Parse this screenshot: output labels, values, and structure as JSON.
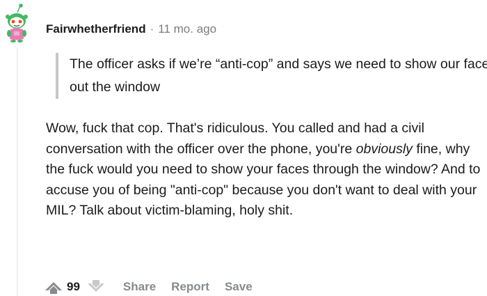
{
  "comment": {
    "author": "Fairwhetherfriend",
    "separator": "·",
    "timestamp": "11 mo. ago",
    "quote": "The officer asks if we’re “anti-cop” and says we need to show our faces out the window",
    "body_part1": "Wow, fuck that cop. That's ridiculous. You called and had a civil conversation with the officer over the phone, you're ",
    "body_emphasis": "obviously",
    "body_part2": " fine, why the fuck would you need to show your faces through the window? And to accuse you of being \"anti-cop\" because you don't want to deal with your MIL? Talk about victim-blaming, holy shit."
  },
  "actions": {
    "score": "99",
    "share_label": "Share",
    "report_label": "Report",
    "save_label": "Save"
  },
  "icons": {
    "avatar": "reddit-snoo-avatar-icon",
    "upvote": "upvote-arrow-icon",
    "downvote": "downvote-arrow-icon"
  },
  "colors": {
    "avatar_body": "#45b764",
    "avatar_shirt": "#ea7ab4",
    "quote_border": "#c7c7c7",
    "meta_gray": "#7c7c7c",
    "action_gray": "#878a8c"
  }
}
